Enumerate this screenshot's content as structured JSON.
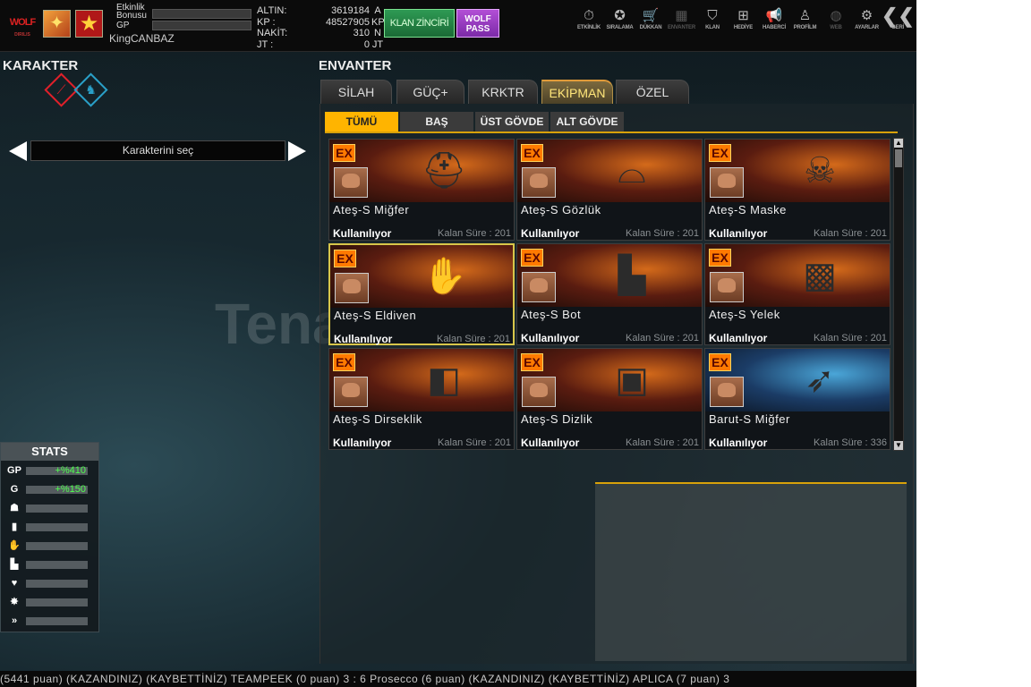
{
  "header": {
    "logo": "WOLF",
    "logo_sub": "DIRILIS",
    "etkinlik_label": "Etkinlik Bonusu",
    "gp_label": "GP",
    "username": "KingCANBAZ",
    "currency": [
      {
        "key": "ALTIN:",
        "value": "3619184",
        "unit": "A"
      },
      {
        "key": "KP :",
        "value": "48527905",
        "unit": "KP"
      },
      {
        "key": "NAKİT:",
        "value": "310",
        "unit": "N"
      },
      {
        "key": "JT :",
        "value": "0",
        "unit": "JT"
      }
    ],
    "klan_button": "KLAN ZİNCİRİ",
    "wolf_pass": "WOLF PASS",
    "nav": [
      {
        "label": "ETKİNLİK",
        "icon": "stopwatch-icon",
        "glyph": "⏱"
      },
      {
        "label": "SIRALAMA",
        "icon": "medal-icon",
        "glyph": "✪"
      },
      {
        "label": "DÜKKAN",
        "icon": "cart-icon",
        "glyph": "🛒"
      },
      {
        "label": "ENVANTER",
        "icon": "inventory-icon",
        "glyph": "▦"
      },
      {
        "label": "KLAN",
        "icon": "shield-icon",
        "glyph": "⛉"
      },
      {
        "label": "HEDİYE",
        "icon": "gift-icon",
        "glyph": "⊞"
      },
      {
        "label": "HABERCİ",
        "icon": "megaphone-icon",
        "glyph": "📢"
      },
      {
        "label": "PROFİLM",
        "icon": "profile-icon",
        "glyph": "♙"
      },
      {
        "label": "WEB",
        "icon": "globe-icon",
        "glyph": "◍"
      },
      {
        "label": "AYARLAR",
        "icon": "gear-icon",
        "glyph": "⚙"
      },
      {
        "label": "GERİ",
        "icon": "back-icon",
        "glyph": "❮❮"
      }
    ]
  },
  "karakter": {
    "title": "KARAKTER",
    "select_label": "Karakterini seç"
  },
  "stats": {
    "title": "STATS",
    "rows": [
      {
        "icon": "GP",
        "value": "+%410"
      },
      {
        "icon": "G",
        "value": "+%150"
      },
      {
        "icon": "helmet-icon",
        "glyph": "☗",
        "value": ""
      },
      {
        "icon": "vest-icon",
        "glyph": "▮",
        "value": ""
      },
      {
        "icon": "glove-icon",
        "glyph": "✋",
        "value": ""
      },
      {
        "icon": "boot-icon",
        "glyph": "▙",
        "value": ""
      },
      {
        "icon": "heart-icon",
        "glyph": "♥",
        "value": ""
      },
      {
        "icon": "burst-icon",
        "glyph": "✸",
        "value": ""
      },
      {
        "icon": "speed-icon",
        "glyph": "»",
        "value": ""
      }
    ]
  },
  "envanter": {
    "title": "ENVANTER",
    "tabs": [
      "SİLAH",
      "GÜÇ+",
      "KRKTR",
      "EKİPMAN",
      "ÖZEL"
    ],
    "active_tab": "EKİPMAN",
    "subtabs": [
      "TÜMÜ",
      "BAŞ",
      "ÜST GÖVDE",
      "ALT GÖVDE"
    ],
    "active_subtab": "TÜMÜ",
    "items": [
      {
        "name": "Ateş-S Miğfer",
        "status": "Kullanılıyor",
        "time": "Kalan Süre : 201",
        "glyph": "⛑",
        "theme": "fire"
      },
      {
        "name": "Ateş-S Gözlük",
        "status": "Kullanılıyor",
        "time": "Kalan Süre : 201",
        "glyph": "⌓",
        "theme": "fire"
      },
      {
        "name": "Ateş-S Maske",
        "status": "Kullanılıyor",
        "time": "Kalan Süre : 201",
        "glyph": "☠",
        "theme": "fire"
      },
      {
        "name": "Ateş-S Eldiven",
        "status": "Kullanılıyor",
        "time": "Kalan Süre : 201",
        "glyph": "✋",
        "theme": "fire"
      },
      {
        "name": "Ateş-S Bot",
        "status": "Kullanılıyor",
        "time": "Kalan Süre : 201",
        "glyph": "▙",
        "theme": "fire"
      },
      {
        "name": "Ateş-S Yelek",
        "status": "Kullanılıyor",
        "time": "Kalan Süre : 201",
        "glyph": "▩",
        "theme": "fire"
      },
      {
        "name": "Ateş-S Dirseklik",
        "status": "Kullanılıyor",
        "time": "Kalan Süre : 201",
        "glyph": "◧",
        "theme": "fire"
      },
      {
        "name": "Ateş-S Dizlik",
        "status": "Kullanılıyor",
        "time": "Kalan Süre : 201",
        "glyph": "▣",
        "theme": "fire"
      },
      {
        "name": "Barut-S Miğfer",
        "status": "Kullanılıyor",
        "time": "Kalan Süre : 336",
        "glyph": "➶",
        "theme": "blue"
      }
    ],
    "selected_index": 3,
    "badge": "EX"
  },
  "watermark": "Tenaseits",
  "ticker": "(5441 puan) (KAZANDINIZ)      (KAYBETTİNİZ) TEAMPEEK (0 puan) 3 : 6 Prosecco (6 puan) (KAZANDINIZ)      (KAYBETTİNİZ) APLICA (7 puan) 3"
}
